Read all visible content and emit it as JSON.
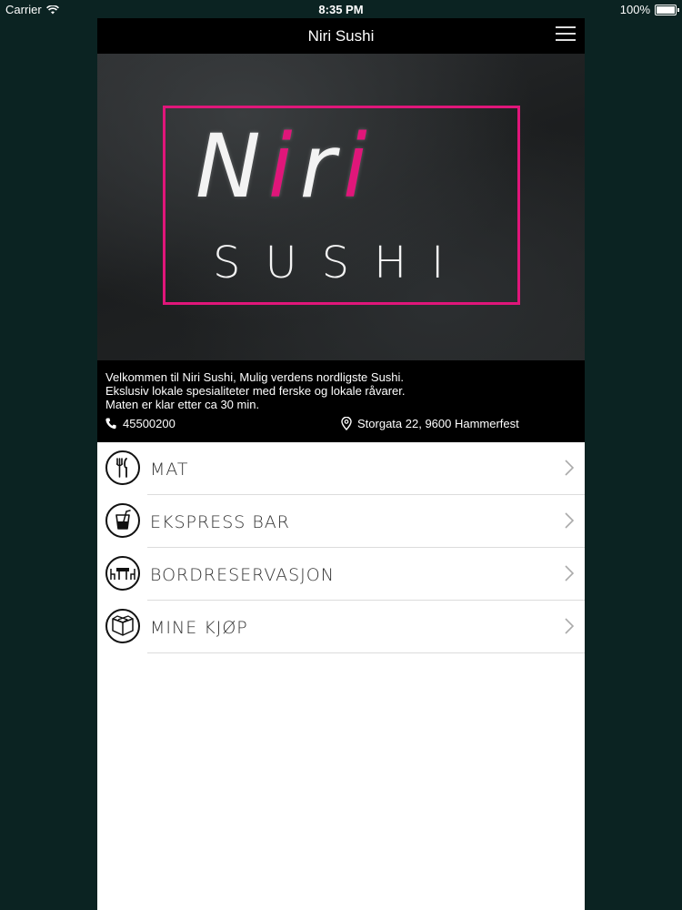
{
  "status_bar": {
    "carrier": "Carrier",
    "time": "8:35 PM",
    "battery": "100%",
    "wifi_icon": "wifi-icon",
    "battery_icon": "battery-icon"
  },
  "header": {
    "title": "Niri Sushi",
    "menu_icon": "hamburger-menu-icon"
  },
  "hero": {
    "logo_letters": [
      "N",
      "i",
      "r",
      "i"
    ],
    "logo_subtitle": "SUSHI",
    "accent_color": "#e0167a"
  },
  "info": {
    "lines": [
      "Velkommen til Niri Sushi, Mulig verdens nordligste Sushi.",
      "Ekslusiv lokale spesialiteter med ferske og lokale råvarer.",
      "Maten er klar etter ca 30 min."
    ],
    "phone": "45500200",
    "address": "Storgata 22, 9600 Hammerfest"
  },
  "menu": {
    "items": [
      {
        "label": "MAT",
        "icon": "cutlery-icon"
      },
      {
        "label": "EKSPRESS BAR",
        "icon": "drink-icon"
      },
      {
        "label": "BORDRESERVASJON",
        "icon": "table-icon"
      },
      {
        "label": "MINE KJØP",
        "icon": "box-icon"
      }
    ]
  }
}
